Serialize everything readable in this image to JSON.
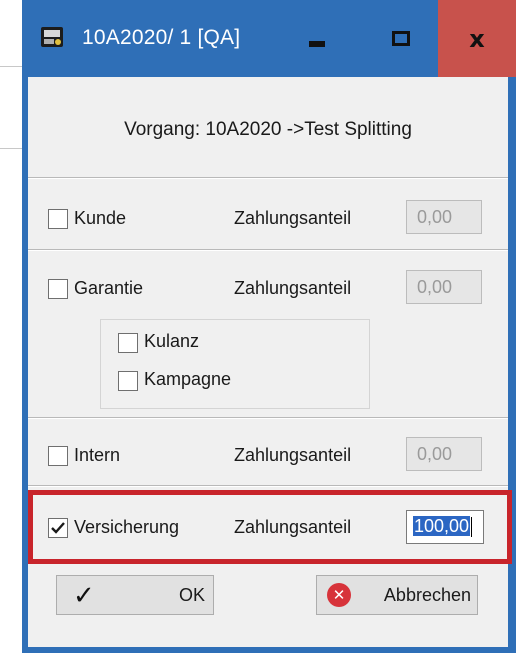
{
  "window": {
    "title": "10A2020/ 1 [QA]",
    "colors": {
      "titlebar": "#2f6fb7",
      "close": "#c8524c",
      "highlight": "#c8242b",
      "selection": "#2b66c3"
    }
  },
  "vorgang": {
    "text": "Vorgang:  10A2020 ->Test Splitting"
  },
  "rows": {
    "kunde": {
      "label": "Kunde",
      "za_label": "Zahlungsanteil",
      "amount": "0,00",
      "checked": false
    },
    "garantie": {
      "label": "Garantie",
      "za_label": "Zahlungsanteil",
      "amount": "0,00",
      "checked": false
    },
    "kulanz": {
      "label": "Kulanz",
      "checked": false
    },
    "kampagne": {
      "label": "Kampagne",
      "checked": false
    },
    "intern": {
      "label": "Intern",
      "za_label": "Zahlungsanteil",
      "amount": "0,00",
      "checked": false
    },
    "versicherung": {
      "label": "Versicherung",
      "za_label": "Zahlungsanteil",
      "amount": "100,00",
      "checked": true
    }
  },
  "buttons": {
    "ok_label": "OK",
    "cancel_label": "Abbrechen"
  },
  "icons": {
    "app": "app-icon",
    "minimize": "minimize-icon",
    "maximize": "maximize-icon",
    "close": "close-icon",
    "ok": "checkmark-icon",
    "cancel": "cancel-icon"
  }
}
